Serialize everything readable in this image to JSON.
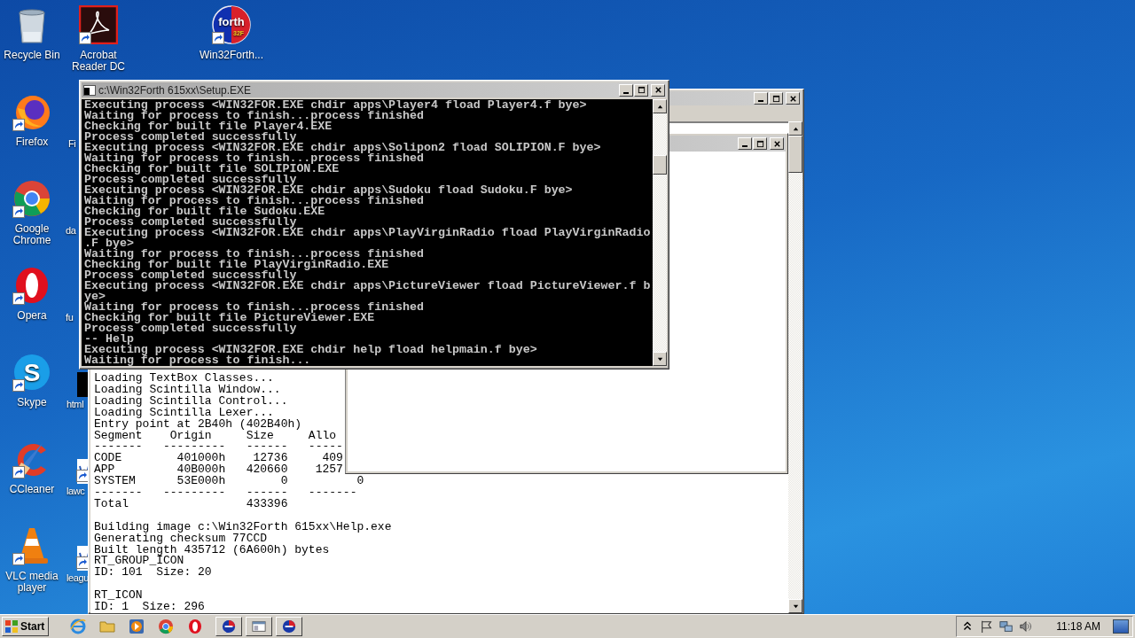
{
  "desktop_icons": [
    {
      "label": "Recycle Bin",
      "kind": "recycle-bin",
      "shortcut": false
    },
    {
      "label": "Acrobat Reader DC",
      "kind": "acrobat",
      "shortcut": true
    },
    {
      "label": "Win32Forth...",
      "kind": "forth",
      "shortcut": true,
      "logo": "forth",
      "logo_sub": "32F"
    },
    {
      "label": "Firefox",
      "kind": "firefox",
      "shortcut": true
    },
    {
      "label": "Fi",
      "kind": "covered",
      "shortcut": false
    },
    {
      "label": "Google Chrome",
      "kind": "chrome",
      "shortcut": true
    },
    {
      "label": "da",
      "kind": "covered",
      "shortcut": false
    },
    {
      "label": "Opera",
      "kind": "opera",
      "shortcut": true
    },
    {
      "label": "fu",
      "kind": "covered",
      "shortcut": false
    },
    {
      "label": "Skype",
      "kind": "skype",
      "shortcut": true,
      "logo": "S"
    },
    {
      "label": "html",
      "kind": "covered-dark",
      "shortcut": false
    },
    {
      "label": "CCleaner",
      "kind": "ccleaner",
      "shortcut": true
    },
    {
      "label": "lawc",
      "kind": "covered-doc",
      "shortcut": true
    },
    {
      "label": "VLC media player",
      "kind": "vlc",
      "shortcut": true
    },
    {
      "label": "leagu",
      "kind": "covered-doc",
      "shortcut": true
    }
  ],
  "ide_window": {
    "output_blocks": [
      [
        "Loading TextBox Classes...",
        "Loading Scintilla Window...",
        "Loading Scintilla Control...",
        "Loading Scintilla Lexer...",
        "Entry point at 2B40h (402B40h)",
        "Segment    Origin     Size     Allo",
        "-------   ---------   ------   -----",
        "CODE        401000h    12736     409",
        "APP         40B000h   420660    1257",
        "SYSTEM      53E000h        0          0",
        "-------   ---------   ------   -------",
        "Total                 433396"
      ],
      [
        "Building image c:\\Win32Forth 615xx\\Help.exe",
        "Generating checksum 77CCD",
        "Built length 435712 (6A600h) bytes",
        "RT_GROUP_ICON",
        "ID: 101  Size: 20"
      ],
      [
        "RT_ICON",
        "ID: 1  Size: 296"
      ]
    ]
  },
  "console_window": {
    "title": "c:\\Win32Forth 615xx\\Setup.EXE",
    "lines": [
      "Executing process <WIN32FOR.EXE chdir apps\\Player4 fload Player4.f bye>",
      "Waiting for process to finish...process finished",
      "Checking for built file Player4.EXE",
      "Process completed successfully",
      "Executing process <WIN32FOR.EXE chdir apps\\Solipon2 fload SOLIPION.F bye>",
      "Waiting for process to finish...process finished",
      "Checking for built file SOLIPION.EXE",
      "Process completed successfully",
      "Executing process <WIN32FOR.EXE chdir apps\\Sudoku fload Sudoku.F bye>",
      "Waiting for process to finish...process finished",
      "Checking for built file Sudoku.EXE",
      "Process completed successfully",
      "Executing process <WIN32FOR.EXE chdir apps\\PlayVirginRadio fload PlayVirginRadio",
      ".F bye>",
      "Waiting for process to finish...process finished",
      "Checking for built file PlayVirginRadio.EXE",
      "Process completed successfully",
      "Executing process <WIN32FOR.EXE chdir apps\\PictureViewer fload PictureViewer.f b",
      "ye>",
      "Waiting for process to finish...process finished",
      "Checking for built file PictureViewer.EXE",
      "Process completed successfully",
      "-- Help",
      "Executing process <WIN32FOR.EXE chdir help fload helpmain.f bye>",
      "Waiting for process to finish..."
    ]
  },
  "taskbar": {
    "start": "Start",
    "quick_launch": [
      {
        "kind": "ie"
      },
      {
        "kind": "folder"
      },
      {
        "kind": "media-player"
      },
      {
        "kind": "chrome"
      },
      {
        "kind": "opera"
      }
    ],
    "tasks": [
      {
        "kind": "forth"
      },
      {
        "kind": "console"
      },
      {
        "kind": "forth"
      }
    ],
    "tray": [
      {
        "kind": "chevron"
      },
      {
        "kind": "flag"
      },
      {
        "kind": "network"
      },
      {
        "kind": "volume"
      }
    ],
    "clock": "11:18 AM"
  }
}
